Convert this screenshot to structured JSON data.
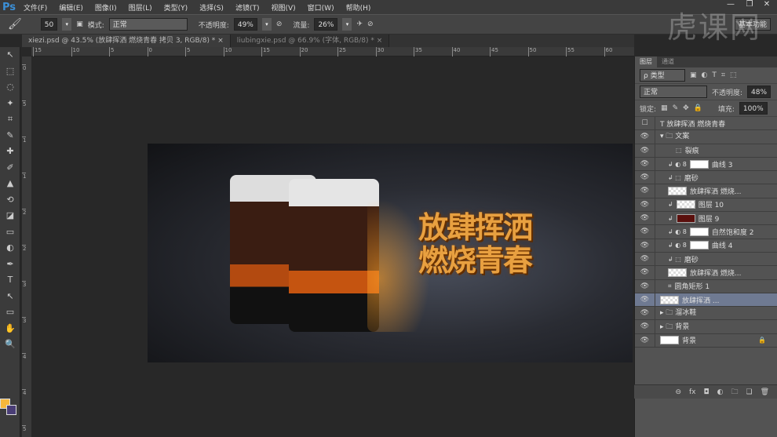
{
  "app": {
    "logo": "Ps",
    "watermark": "虎课网",
    "workspace": "基本功能"
  },
  "menu": [
    "文件(F)",
    "编辑(E)",
    "图像(I)",
    "图层(L)",
    "类型(Y)",
    "选择(S)",
    "滤镜(T)",
    "视图(V)",
    "窗口(W)",
    "帮助(H)"
  ],
  "window_controls": [
    "—",
    "❐",
    "✕"
  ],
  "options": {
    "brush_size": "50",
    "mode_label": "模式:",
    "mode_value": "正常",
    "opacity_label": "不透明度:",
    "opacity_value": "49%",
    "flow_label": "流量:",
    "flow_value": "26%"
  },
  "tabs": [
    {
      "label": "xiezi.psd @ 43.5% (放肆挥洒    燃烧青春 拷贝 3, RGB/8) *",
      "close": "×"
    },
    {
      "label": "liubingxie.psd @ 66.9% (字体, RGB/8) *",
      "close": "×"
    }
  ],
  "ruler": [
    "15",
    "10",
    "5",
    "0",
    "5",
    "10",
    "15",
    "20",
    "25",
    "30",
    "35",
    "40",
    "45",
    "50",
    "55",
    "60"
  ],
  "vruler": [
    "0",
    "5",
    "1",
    "1",
    "2",
    "2",
    "3",
    "3",
    "4",
    "4",
    "5"
  ],
  "artwork": {
    "line1": "放肆挥洒",
    "line2": "燃烧青春"
  },
  "tools": [
    "↖",
    "⬚",
    "◌",
    "✦",
    "⌗",
    "✎",
    "✚",
    "✐",
    "▲",
    "⟲",
    "◪",
    "▭",
    "◐",
    "✒",
    "T",
    "↖",
    "▭",
    "✋",
    "🔍"
  ],
  "colors": {
    "foreground": "#f6b73c",
    "background": "#4a3e76",
    "selection": "#6f7a92"
  },
  "panel": {
    "tabs": [
      "图层",
      "通道"
    ],
    "filter": "ρ 类型",
    "blend": "正常",
    "opacity_label": "不透明度:",
    "opacity": "48%",
    "lock_label": "锁定:",
    "fill_label": "填充:",
    "fill": "100%",
    "layers": [
      {
        "name": "T  放肆挥洒      燃烧青春",
        "indent": 0,
        "visible": false,
        "thumb": "none"
      },
      {
        "name": "▾ 🗀 文案",
        "indent": 0,
        "visible": true,
        "thumb": "none"
      },
      {
        "name": "裂痕",
        "indent": 2,
        "visible": true,
        "thumb": "none",
        "icon": "⬚"
      },
      {
        "name": "曲线 3",
        "indent": 1,
        "visible": true,
        "thumb": "white",
        "icon": "↲ ◐ 8"
      },
      {
        "name": "磨砂",
        "indent": 1,
        "visible": true,
        "thumb": "none",
        "icon": "↲ ⬚"
      },
      {
        "name": "放肆挥洒     燃烧...",
        "indent": 1,
        "visible": true,
        "thumb": "check"
      },
      {
        "name": "图层 10",
        "indent": 1,
        "visible": true,
        "thumb": "check",
        "icon": "↲"
      },
      {
        "name": "图层 9",
        "indent": 1,
        "visible": true,
        "thumb": "red",
        "icon": "↲"
      },
      {
        "name": "自然饱和度 2",
        "indent": 1,
        "visible": true,
        "thumb": "white",
        "icon": "↲ ◐ 8"
      },
      {
        "name": "曲线 4",
        "indent": 1,
        "visible": true,
        "thumb": "white",
        "icon": "↲ ◐ 8"
      },
      {
        "name": "磨砂",
        "indent": 1,
        "visible": true,
        "thumb": "none",
        "icon": "↲ ⬚"
      },
      {
        "name": "放肆挥洒     燃烧...",
        "indent": 1,
        "visible": true,
        "thumb": "check"
      },
      {
        "name": "圆角矩形 1",
        "indent": 1,
        "visible": true,
        "thumb": "none",
        "icon": "⌗"
      },
      {
        "name": "放肆挥洒         ...",
        "indent": 0,
        "visible": true,
        "thumb": "check",
        "selected": true,
        "icon": ""
      },
      {
        "name": "▸ 🗀 溜冰鞋",
        "indent": 0,
        "visible": true,
        "thumb": "none"
      },
      {
        "name": "▸ 🗀 背景",
        "indent": 0,
        "visible": true,
        "thumb": "none"
      },
      {
        "name": "背景",
        "indent": 0,
        "visible": true,
        "thumb": "white",
        "lock": "🔒"
      }
    ],
    "bottom_icons": [
      "⊖",
      "fx",
      "◘",
      "◐",
      "🗀",
      "❏",
      "🗑"
    ]
  }
}
